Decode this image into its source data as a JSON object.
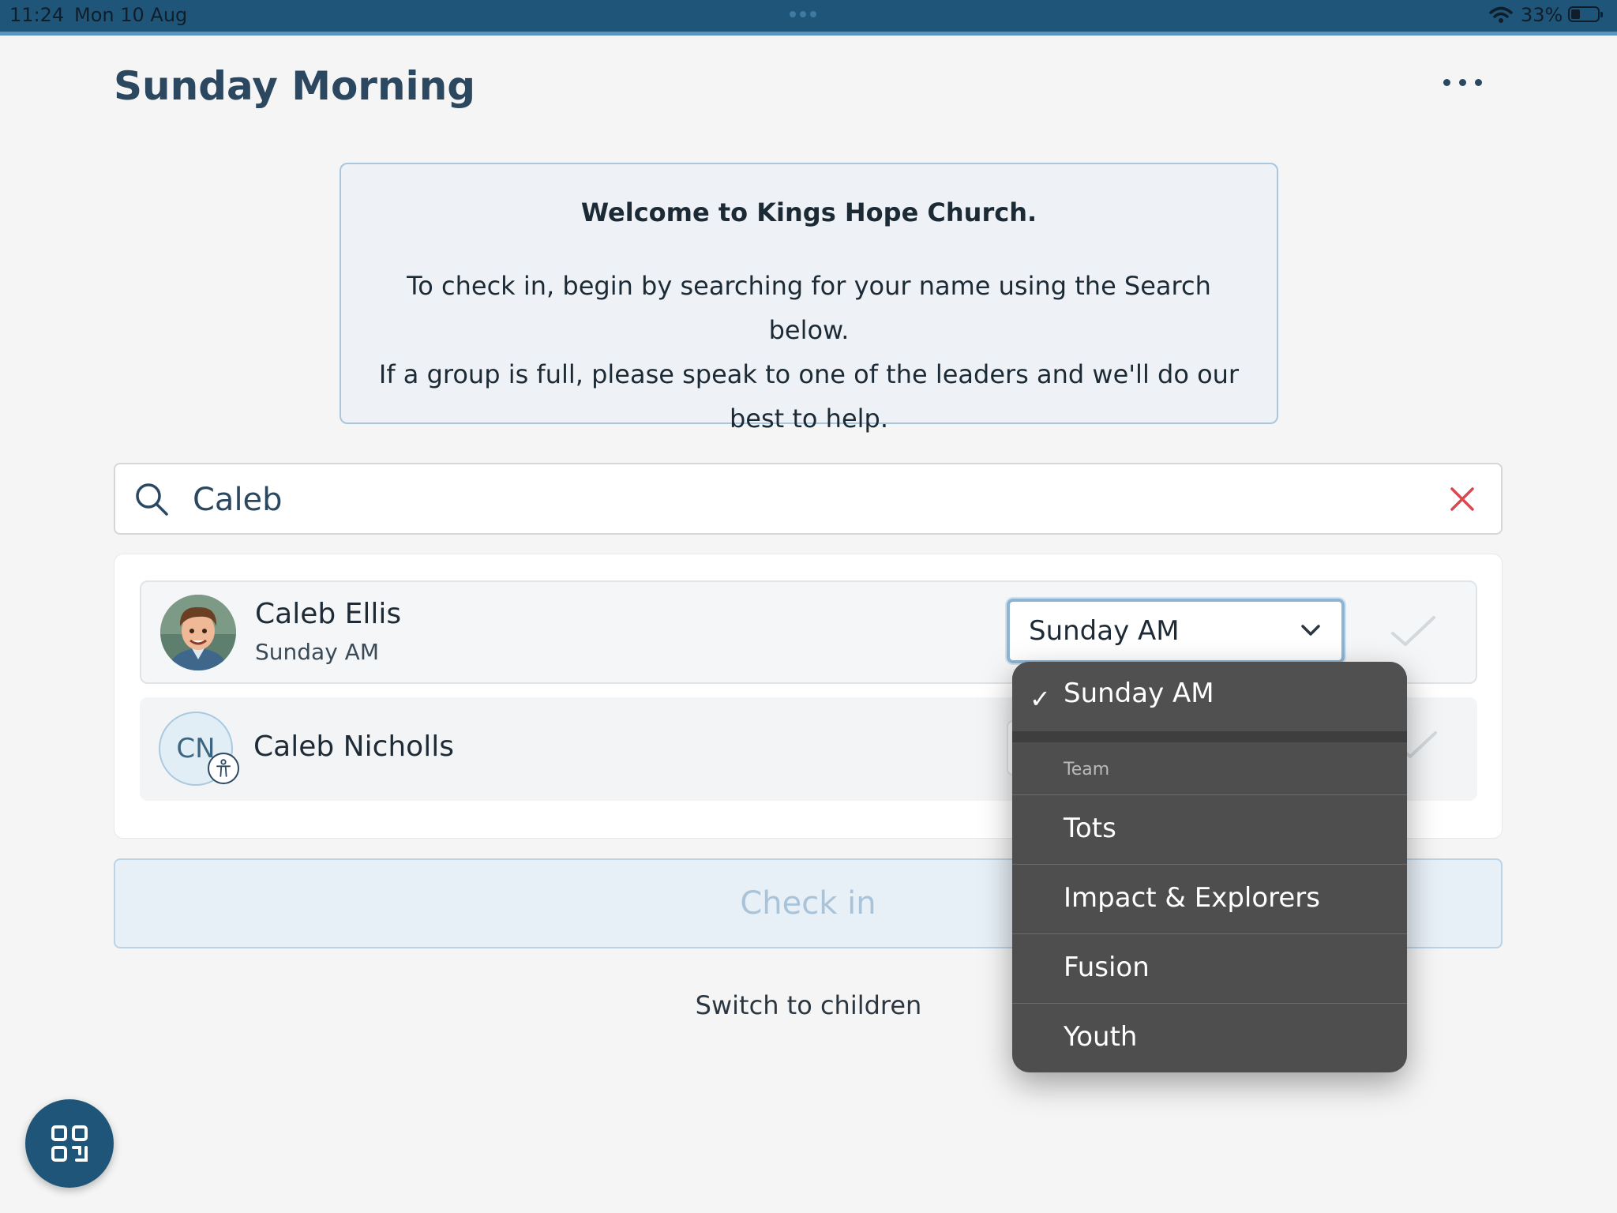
{
  "status_bar": {
    "time": "11:24",
    "date": "Mon 10 Aug",
    "battery": "33%"
  },
  "header": {
    "title": "Sunday Morning",
    "more_icon": "more-horizontal-icon"
  },
  "welcome": {
    "title": "Welcome to Kings Hope Church.",
    "line1": "To check in, begin by searching for your name using the Search below.",
    "line2": "If a group is full, please speak to one of the leaders and we'll do our best to help."
  },
  "search": {
    "value": "Caleb",
    "icon": "search-icon",
    "clear_icon": "close-icon"
  },
  "results": [
    {
      "name": "Caleb Ellis",
      "group": "Sunday AM",
      "avatar": "photo"
    },
    {
      "name": "Caleb Nicholls",
      "initials": "CN",
      "badge_icon": "accessibility-icon"
    }
  ],
  "group_select": {
    "value": "Sunday AM"
  },
  "dropdown": {
    "selected": "Sunday AM",
    "section_label": "Team",
    "options": [
      "Tots",
      "Impact & Explorers",
      "Fusion",
      "Youth"
    ]
  },
  "checkin_button": "Check in",
  "switch_link": "Switch to children",
  "colors": {
    "accent": "#1f5578",
    "title": "#2c4860",
    "clear": "#d9474f",
    "menu": "#4e4e4e"
  }
}
